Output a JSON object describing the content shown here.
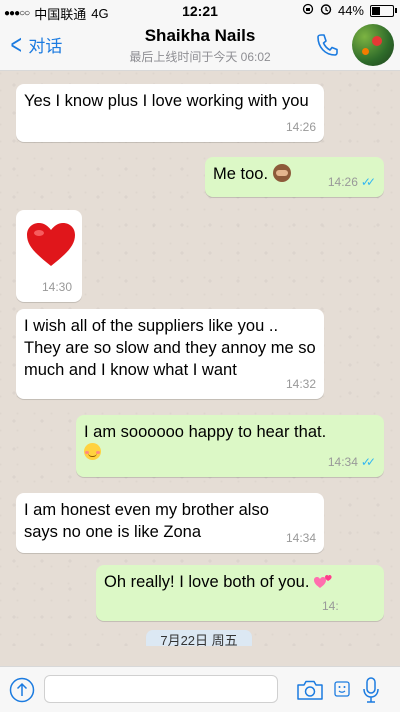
{
  "status_bar": {
    "carrier": "中国联通",
    "network": "4G",
    "time": "12:21",
    "battery": "44%",
    "battery_level": 0.44
  },
  "header": {
    "back_label": "对话",
    "contact_name": "Shaikha Nails",
    "last_seen": "最后上线时间于今天 06:02"
  },
  "messages": [
    {
      "direction": "in",
      "text": "Yes I know plus I love working with you",
      "time": "14:26"
    },
    {
      "direction": "out",
      "text": "Me too.",
      "emoji": "see-no-evil-monkey",
      "time": "14:26",
      "read": true
    },
    {
      "direction": "in",
      "emoji": "red-heart",
      "time": "14:30"
    },
    {
      "direction": "in",
      "text": "I wish all of the suppliers like you .. They are so slow and they annoy me so much and I know what I want",
      "time": "14:32"
    },
    {
      "direction": "out",
      "text": "I am soooooo happy to hear that.",
      "emoji": "smiling-face",
      "time": "14:34",
      "read": true
    },
    {
      "direction": "in",
      "text": "I am honest even my brother also says no one is like Zona",
      "time": "14:34"
    },
    {
      "direction": "out",
      "text": "Oh really! I love both of you.",
      "emoji": "two-hearts",
      "time": "14:"
    }
  ],
  "date_badge": "7月22日 周五",
  "input": {
    "value": "",
    "placeholder": ""
  },
  "colors": {
    "accent": "#1b7be0",
    "outgoing_bubble": "#dcf8c6",
    "incoming_bubble": "#ffffff",
    "chat_background": "#e5ddd5",
    "read_ticks": "#34b7f1"
  }
}
